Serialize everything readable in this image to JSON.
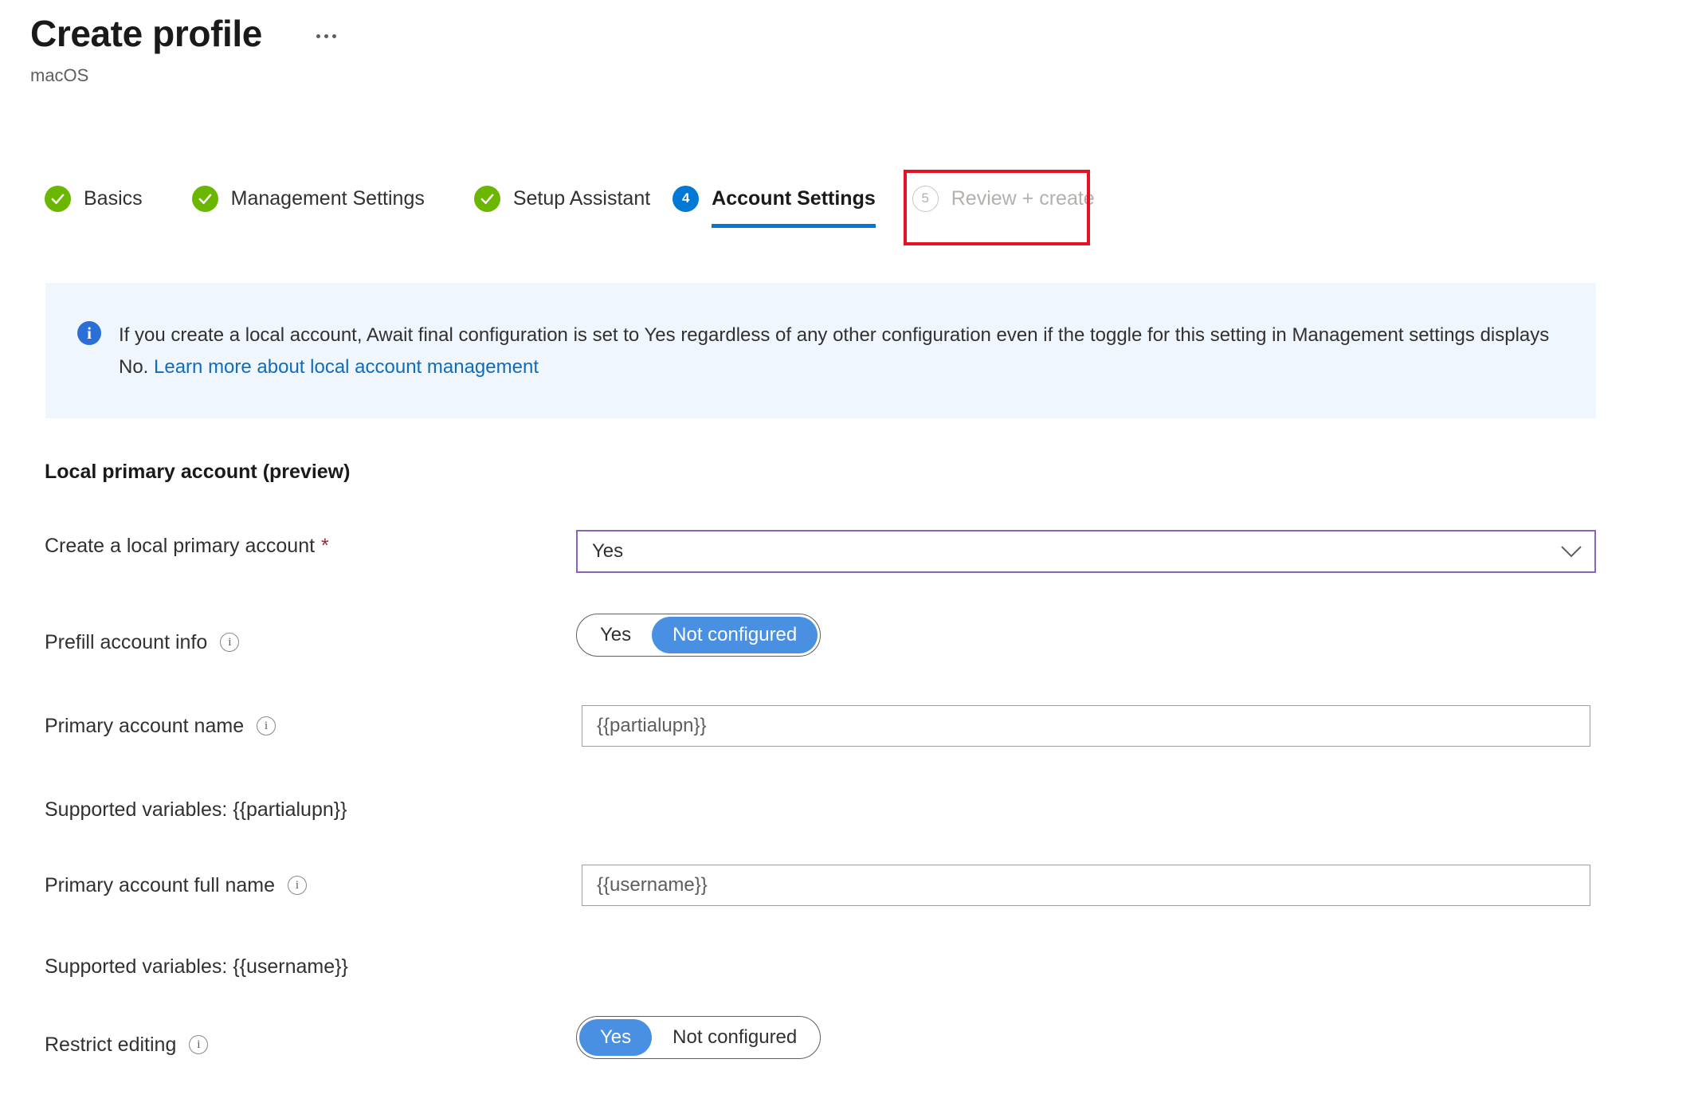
{
  "header": {
    "title": "Create profile",
    "subtitle": "macOS",
    "overflow_menu_label": "More options"
  },
  "wizard": {
    "tabs": [
      {
        "label": "Basics",
        "state": "done",
        "badge": "check"
      },
      {
        "label": "Management Settings",
        "state": "done",
        "badge": "check"
      },
      {
        "label": "Setup Assistant",
        "state": "done",
        "badge": "check"
      },
      {
        "label": "Account Settings",
        "state": "active",
        "badge": "4"
      },
      {
        "label": "Review + create",
        "state": "disabled",
        "badge": "5"
      }
    ]
  },
  "info_banner": {
    "text": "If you create a local account, Await final configuration is set to Yes regardless of any other configuration even if the toggle for this setting in Management settings displays No. ",
    "link_text": "Learn more about local account management"
  },
  "section": {
    "heading": "Local primary account (preview)"
  },
  "fields": {
    "create_local_primary_account": {
      "label": "Create a local primary account",
      "required_marker": "*",
      "value": "Yes"
    },
    "prefill_account_info": {
      "label": "Prefill account info",
      "option_a": "Yes",
      "option_b": "Not configured",
      "selected": "Not configured"
    },
    "primary_account_name": {
      "label": "Primary account name",
      "value": "{{partialupn}}",
      "helper": "Supported variables: {{partialupn}}"
    },
    "primary_account_full_name": {
      "label": "Primary account full name",
      "value": "{{username}}",
      "helper": "Supported variables: {{username}}"
    },
    "restrict_editing": {
      "label": "Restrict editing",
      "option_a": "Yes",
      "option_b": "Not configured",
      "selected": "Yes"
    }
  },
  "colors": {
    "accent_blue": "#0078d4",
    "toggle_blue": "#4a90e2",
    "success_green": "#6bb700",
    "highlight_red": "#e81123",
    "dropdown_purple": "#8764b8",
    "link_blue": "#0f6cbd",
    "banner_bg": "#f0f6fd",
    "required_red": "#a4262c"
  }
}
